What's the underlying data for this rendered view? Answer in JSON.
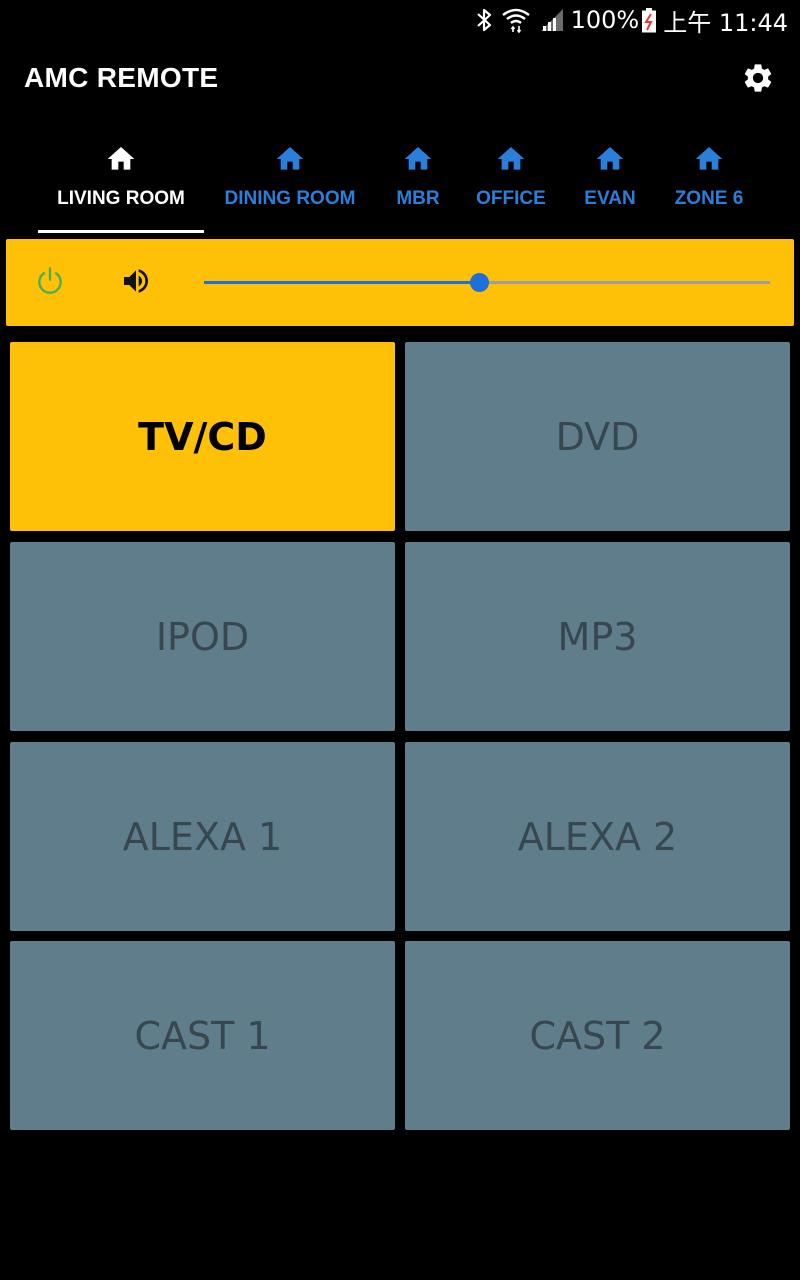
{
  "status_bar": {
    "battery": "100%",
    "time": "上午 11:44",
    "icons": [
      "bluetooth-icon",
      "wifi-icon",
      "signal-icon",
      "battery-icon"
    ]
  },
  "app_bar": {
    "title": "AMC REMOTE",
    "settings_icon": "gear-icon"
  },
  "tabs": [
    {
      "label": "LIVING ROOM",
      "icon": "home-icon",
      "active": true
    },
    {
      "label": "DINING ROOM",
      "icon": "home-icon",
      "active": false
    },
    {
      "label": "MBR",
      "icon": "home-icon",
      "active": false
    },
    {
      "label": "OFFICE",
      "icon": "home-icon",
      "active": false
    },
    {
      "label": "EVAN",
      "icon": "home-icon",
      "active": false
    },
    {
      "label": "ZONE 6",
      "icon": "home-icon",
      "active": false
    }
  ],
  "controls": {
    "power_icon": "power-icon",
    "volume_icon": "volume-icon",
    "volume_level": 0.485
  },
  "sources": [
    {
      "label": "TV/CD",
      "active": true
    },
    {
      "label": "DVD",
      "active": false
    },
    {
      "label": "IPOD",
      "active": false
    },
    {
      "label": "MP3",
      "active": false
    },
    {
      "label": "ALEXA 1",
      "active": false
    },
    {
      "label": "ALEXA 2",
      "active": false
    },
    {
      "label": "CAST 1",
      "active": false
    },
    {
      "label": "CAST 2",
      "active": false
    }
  ],
  "colors": {
    "accent": "#ffc107",
    "tab_inactive": "#2a7fdb",
    "slider": "#1e6fd9",
    "source_inactive": "#607d8b",
    "power": "#4caf50"
  }
}
